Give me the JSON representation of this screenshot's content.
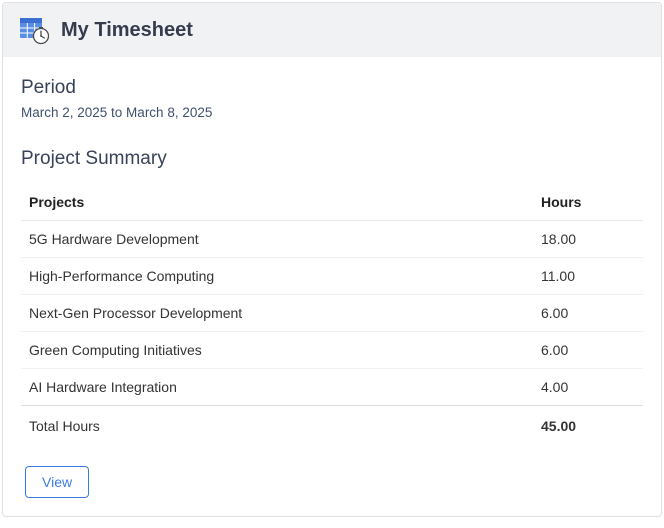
{
  "header": {
    "title": "My Timesheet",
    "icon": "timesheet-clock-icon"
  },
  "period": {
    "label": "Period",
    "text": "March 2, 2025 to March 8, 2025"
  },
  "summary": {
    "title": "Project Summary",
    "columns": {
      "projects": "Projects",
      "hours": "Hours"
    },
    "rows": [
      {
        "project": "5G Hardware Development",
        "hours": "18.00"
      },
      {
        "project": "High-Performance Computing",
        "hours": "11.00"
      },
      {
        "project": "Next-Gen Processor Development",
        "hours": "6.00"
      },
      {
        "project": "Green Computing Initiatives",
        "hours": "6.00"
      },
      {
        "project": "AI Hardware Integration",
        "hours": "4.00"
      }
    ],
    "total": {
      "label": "Total Hours",
      "hours": "45.00"
    }
  },
  "actions": {
    "view_label": "View"
  },
  "colors": {
    "accent": "#3b7ddd",
    "heading": "#384259"
  },
  "chart_data": {
    "type": "table",
    "title": "Project Summary",
    "columns": [
      "Projects",
      "Hours"
    ],
    "rows": [
      [
        "5G Hardware Development",
        18.0
      ],
      [
        "High-Performance Computing",
        11.0
      ],
      [
        "Next-Gen Processor Development",
        6.0
      ],
      [
        "Green Computing Initiatives",
        6.0
      ],
      [
        "AI Hardware Integration",
        4.0
      ]
    ],
    "total": [
      "Total Hours",
      45.0
    ]
  }
}
